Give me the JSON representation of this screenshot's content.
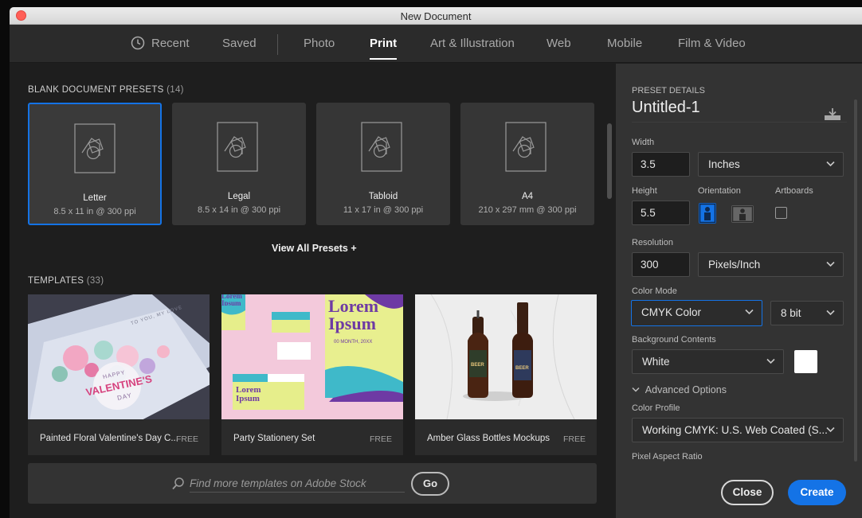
{
  "window": {
    "title": "New Document"
  },
  "tabs": [
    {
      "label": "Recent",
      "icon": "clock-icon"
    },
    {
      "label": "Saved"
    },
    {
      "label": "Photo"
    },
    {
      "label": "Print",
      "active": true
    },
    {
      "label": "Art & Illustration"
    },
    {
      "label": "Web"
    },
    {
      "label": "Mobile"
    },
    {
      "label": "Film & Video"
    }
  ],
  "presets": {
    "title": "BLANK DOCUMENT PRESETS",
    "count": "(14)",
    "items": [
      {
        "name": "Letter",
        "size": "8.5 x 11 in @ 300 ppi",
        "selected": true
      },
      {
        "name": "Legal",
        "size": "8.5 x 14 in @ 300 ppi"
      },
      {
        "name": "Tabloid",
        "size": "11 x 17 in @ 300 ppi"
      },
      {
        "name": "A4",
        "size": "210 x 297 mm @ 300 ppi"
      }
    ],
    "view_all": "View All Presets +"
  },
  "templates": {
    "title": "TEMPLATES",
    "count": "(33)",
    "items": [
      {
        "name": "Painted Floral Valentine's Day C...",
        "badge": "FREE",
        "image_text": [
          "HAPPY",
          "VALENTINE'S",
          "DAY",
          "TO YOU, MY LOVE"
        ]
      },
      {
        "name": "Party Stationery Set",
        "badge": "FREE",
        "image_text": [
          "Lorem Ipsum",
          "00 MONTH, 20XX",
          "Lorem Ipsum",
          "Lorem Ipsum"
        ]
      },
      {
        "name": "Amber Glass Bottles Mockups",
        "badge": "FREE",
        "image_text": [
          "BEER",
          "BEER"
        ]
      }
    ]
  },
  "search": {
    "placeholder": "Find more templates on Adobe Stock",
    "go_label": "Go"
  },
  "details": {
    "section_title": "PRESET DETAILS",
    "doc_name": "Untitled-1",
    "width_label": "Width",
    "width_value": "3.5",
    "width_unit": "Inches",
    "height_label": "Height",
    "height_value": "5.5",
    "orientation_label": "Orientation",
    "artboards_label": "Artboards",
    "resolution_label": "Resolution",
    "resolution_value": "300",
    "resolution_unit": "Pixels/Inch",
    "color_mode_label": "Color Mode",
    "color_mode_value": "CMYK Color",
    "bit_depth": "8 bit",
    "bg_label": "Background Contents",
    "bg_value": "White",
    "bg_swatch_color": "#ffffff",
    "advanced_label": "Advanced Options",
    "color_profile_label": "Color Profile",
    "color_profile_value": "Working CMYK: U.S. Web Coated (S...",
    "pixel_aspect_label": "Pixel Aspect Ratio"
  },
  "actions": {
    "close_label": "Close",
    "create_label": "Create"
  },
  "colors": {
    "accent": "#1473e6",
    "panel": "#333333",
    "background": "#1e1e1e"
  }
}
